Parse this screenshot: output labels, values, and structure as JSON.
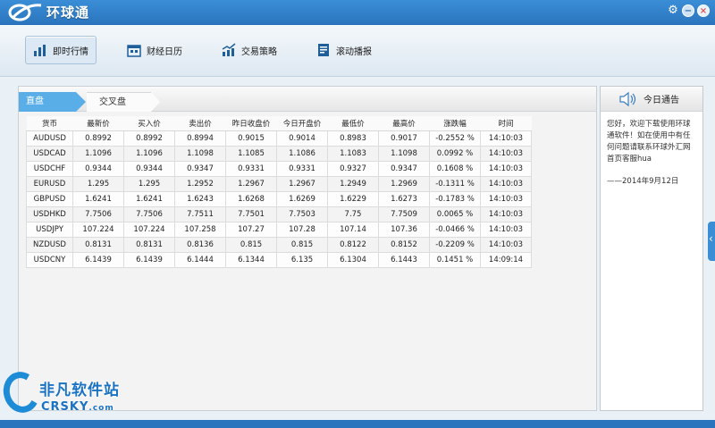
{
  "app": {
    "title": "环球通"
  },
  "window_controls": [
    "gear-icon",
    "minimize-icon",
    "close-icon"
  ],
  "colors": {
    "titlebar": "#2f80ca",
    "active_tab": "#5aaee8",
    "accent": "#1a72c2"
  },
  "toolbar": {
    "items": [
      {
        "label": "即时行情",
        "icon": "bar-chart-icon",
        "active": true
      },
      {
        "label": "财经日历",
        "icon": "calendar-icon",
        "active": false
      },
      {
        "label": "交易策略",
        "icon": "trend-chart-icon",
        "active": false
      },
      {
        "label": "滚动播报",
        "icon": "document-icon",
        "active": false
      }
    ]
  },
  "tabs": [
    {
      "label": "直盘"
    },
    {
      "label": "交叉盘"
    }
  ],
  "table": {
    "headers": [
      "货币",
      "最新价",
      "买入价",
      "卖出价",
      "昨日收盘价",
      "今日开盘价",
      "最低价",
      "最高价",
      "涨跌幅",
      "时间"
    ],
    "rows": [
      [
        "AUDUSD",
        "0.8992",
        "0.8992",
        "0.8994",
        "0.9015",
        "0.9014",
        "0.8983",
        "0.9017",
        "-0.2552 %",
        "14:10:03"
      ],
      [
        "USDCAD",
        "1.1096",
        "1.1096",
        "1.1098",
        "1.1085",
        "1.1086",
        "1.1083",
        "1.1098",
        "0.0992 %",
        "14:10:03"
      ],
      [
        "USDCHF",
        "0.9344",
        "0.9344",
        "0.9347",
        "0.9331",
        "0.9331",
        "0.9327",
        "0.9347",
        "0.1608 %",
        "14:10:03"
      ],
      [
        "EURUSD",
        "1.295",
        "1.295",
        "1.2952",
        "1.2967",
        "1.2967",
        "1.2949",
        "1.2969",
        "-0.1311 %",
        "14:10:03"
      ],
      [
        "GBPUSD",
        "1.6241",
        "1.6241",
        "1.6243",
        "1.6268",
        "1.6269",
        "1.6229",
        "1.6273",
        "-0.1783 %",
        "14:10:03"
      ],
      [
        "USDHKD",
        "7.7506",
        "7.7506",
        "7.7511",
        "7.7501",
        "7.7503",
        "7.75",
        "7.7509",
        "0.0065 %",
        "14:10:03"
      ],
      [
        "USDJPY",
        "107.224",
        "107.224",
        "107.258",
        "107.27",
        "107.28",
        "107.14",
        "107.36",
        "-0.0466 %",
        "14:10:03"
      ],
      [
        "NZDUSD",
        "0.8131",
        "0.8131",
        "0.8136",
        "0.815",
        "0.815",
        "0.8122",
        "0.8152",
        "-0.2209 %",
        "14:10:03"
      ],
      [
        "USDCNY",
        "6.1439",
        "6.1439",
        "6.1444",
        "6.1344",
        "6.135",
        "6.1304",
        "6.1443",
        "0.1451 %",
        "14:09:14"
      ]
    ]
  },
  "notice": {
    "title": "今日通告",
    "message": "您好，欢迎下载使用环球通软件！如在使用中有任何问题请联系环球外汇网首页客服hua",
    "signature": "——2014年9月12日"
  },
  "watermark": {
    "cn": "非凡软件站",
    "en": "CRSKY",
    "suffix": ".com"
  }
}
